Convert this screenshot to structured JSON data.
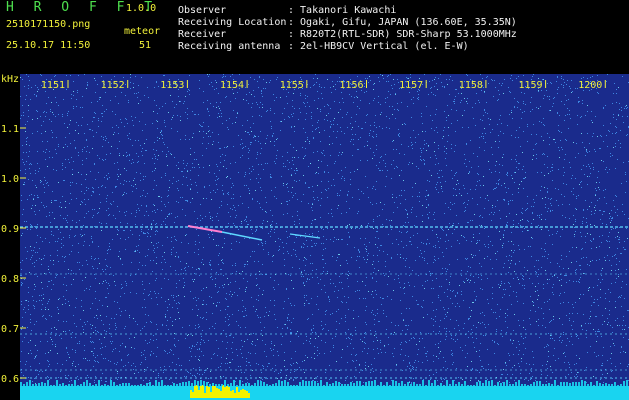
{
  "header": {
    "app_title": "H R O F F T",
    "app_version": "1.0.0",
    "file_name": "2510171150.png",
    "date_time": "25.10.17 11:50",
    "meteor_label": "meteor",
    "meteor_count": "51",
    "info": [
      {
        "key": "Observer",
        "value": ": Takanori Kawachi"
      },
      {
        "key": "Receiving Location",
        "value": ": Ogaki, Gifu, JAPAN (136.60E, 35.35N)"
      },
      {
        "key": "Receiver",
        "value": ": R820T2(RTL-SDR) SDR-Sharp 53.1000MHz"
      },
      {
        "key": "Receiving antenna",
        "value": ": 2el-HB9CV Vertical (el. E-W)"
      }
    ]
  },
  "spectrogram": {
    "y_unit_label": "kHz",
    "x_tick_labels": [
      "1151",
      "1152",
      "1153",
      "1154",
      "1155",
      "1156",
      "1157",
      "1158",
      "1159",
      "1200"
    ],
    "y_tick_labels": [
      "1.1",
      "1.0",
      "0.9",
      "0.8",
      "0.7",
      "0.6"
    ],
    "colors": {
      "background": "#1a2b8c",
      "noise_dot": "#4aa6ff",
      "bright_dot": "#7ff0ff",
      "signal_line": "#5fd8ff",
      "meteor_echo": "#ff7fd0",
      "bottom_band": "#19d4f0",
      "yellow_band": "#f2f200"
    }
  }
}
